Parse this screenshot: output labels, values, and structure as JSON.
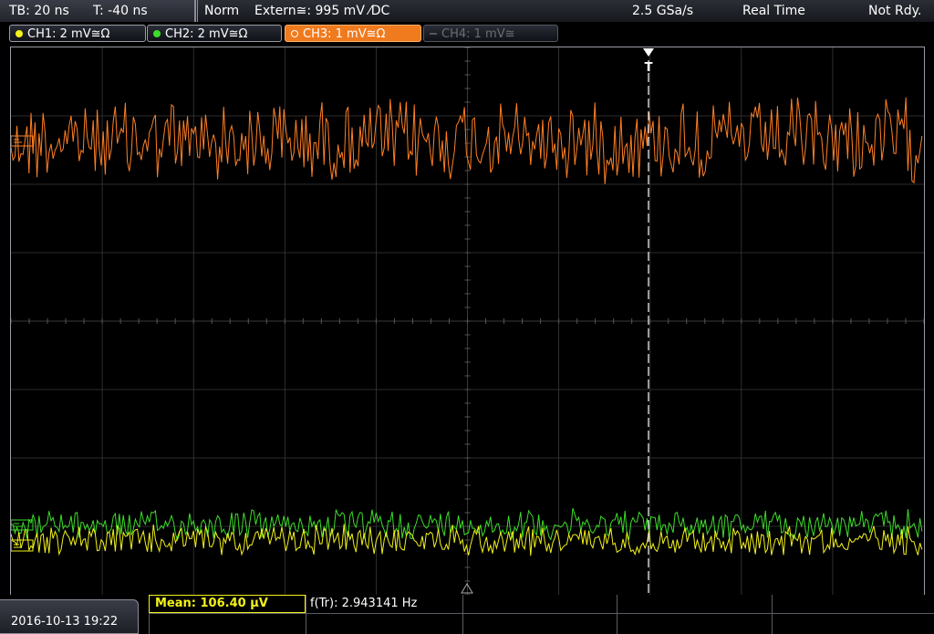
{
  "topbar": {
    "timebase": "TB: 20 ns",
    "trigger_time": "T: -40 ns",
    "mode": "Norm",
    "trigger_source": "Extern≅: 995 mV ⁄DC",
    "sample_rate": "2.5 GSa/s",
    "acq_mode": "Real Time",
    "status": "Not Rdy."
  },
  "channels": [
    {
      "label": "CH1: 2 mV≅Ω",
      "color": "#f2f21a",
      "state": "on"
    },
    {
      "label": "CH2: 2 mV≅Ω",
      "color": "#3ddc2a",
      "state": "on"
    },
    {
      "label": "CH3: 1 mV≅Ω",
      "color": "#ff7f24",
      "state": "active"
    },
    {
      "label": "CH4: 1 mV≅",
      "color": "#6b6d74",
      "state": "off"
    }
  ],
  "trigger_marker": "T",
  "bottom": {
    "datetime": "2016-10-13 19:22",
    "mean": "Mean: 106.40 µV",
    "freq": "f(Tr): 2.943141 Hz"
  },
  "colors": {
    "ch1": "#f2f21a",
    "ch2": "#3ddc2a",
    "ch3": "#ff7f24",
    "grid": "#3a3a3a"
  }
}
